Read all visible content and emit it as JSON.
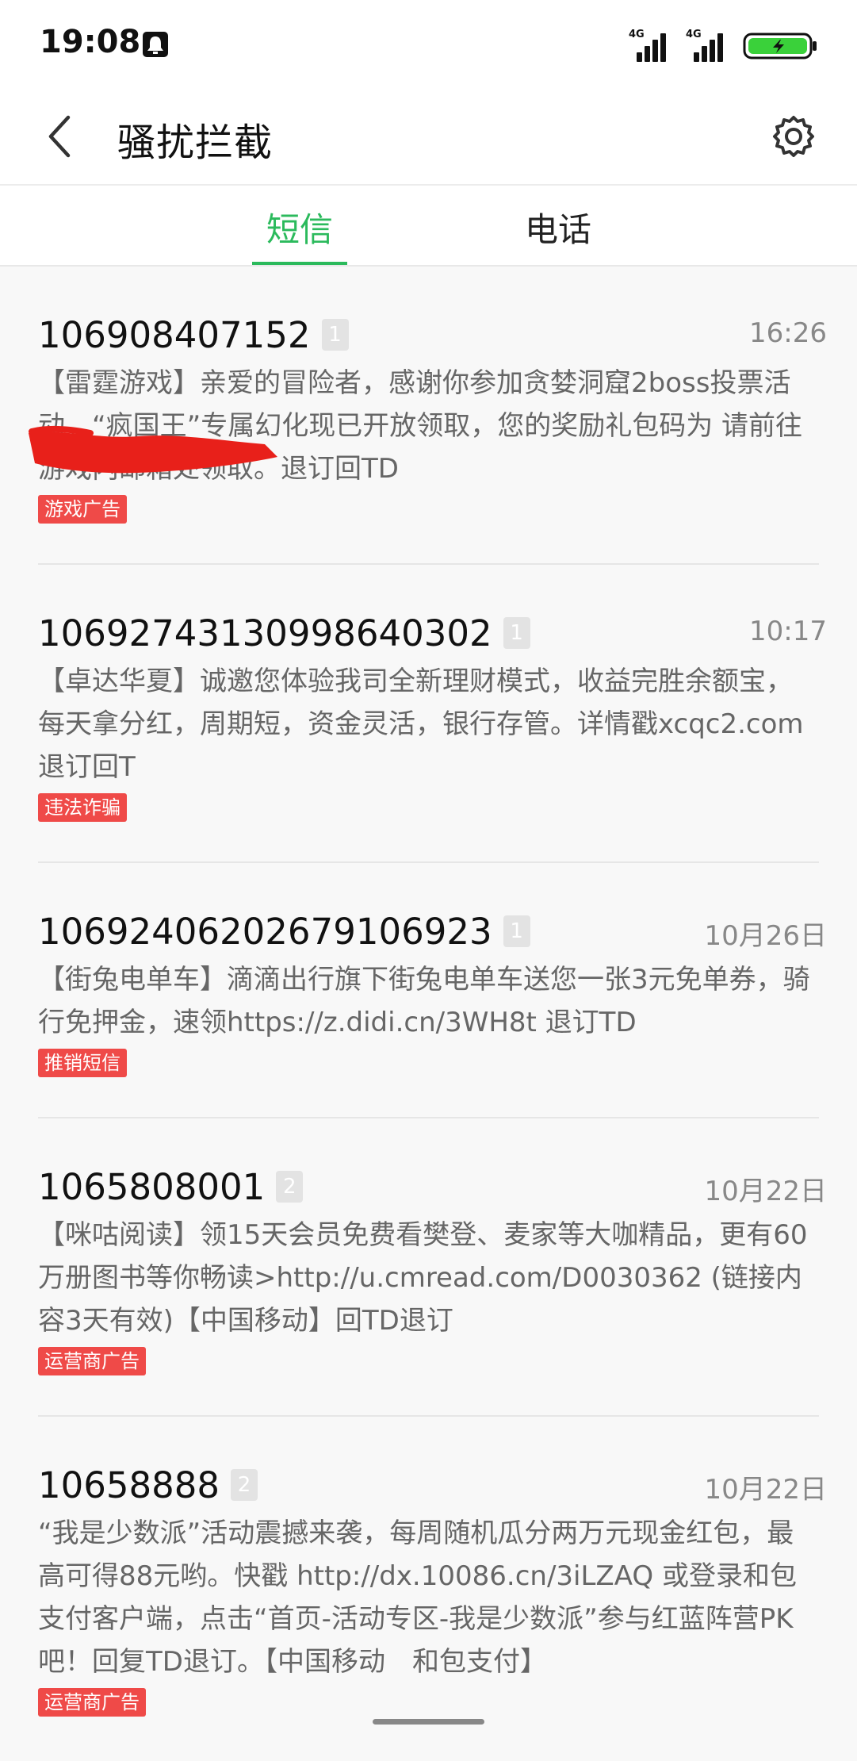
{
  "status_bar": {
    "time": "19:08",
    "network_label_1": "4G",
    "network_label_2": "4G"
  },
  "header": {
    "title": "骚扰拦截",
    "back_icon": "chevron-left-icon",
    "settings_icon": "gear-icon"
  },
  "tabs": [
    {
      "label": "短信",
      "active": true
    },
    {
      "label": "电话",
      "active": false
    }
  ],
  "colors": {
    "accent": "#2bba5c",
    "tag": "#ef4a48",
    "battery": "#3ad13a"
  },
  "messages": [
    {
      "sender": "106908407152",
      "count": "1",
      "time": "16:26",
      "body": "【雷霆游戏】亲爱的冒险者，感谢你参加贪婪洞窟2boss投票活动，“疯国王”专属幻化现已开放领取，您的奖励礼包码为           请前往游戏内邮箱处领取。退订回TD",
      "tag": "游戏广告"
    },
    {
      "sender": "10692743130998640302",
      "count": "1",
      "time": "10:17",
      "body": "【卓达华夏】诚邀您体验我司全新理财模式，收益完胜余额宝，每天拿分红，周期短，资金灵活，银行存管。详情戳xcqc2.com 退订回T",
      "tag": "违法诈骗"
    },
    {
      "sender": "10692406202679106923",
      "count": "1",
      "time": "10月26日",
      "body": "【街兔电单车】滴滴出行旗下街兔电单车送您一张3元免单券，骑行免押金，速领https://z.didi.cn/3WH8t 退订TD",
      "tag": "推销短信"
    },
    {
      "sender": "1065808001",
      "count": "2",
      "time": "10月22日",
      "body": "【咪咕阅读】领15天会员免费看樊登、麦家等大咖精品，更有60万册图书等你畅读>http://u.cmread.com/D0030362 (链接内容3天有效)【中国移动】回TD退订",
      "tag": "运营商广告"
    },
    {
      "sender": "10658888",
      "count": "2",
      "time": "10月22日",
      "body": "“我是少数派”活动震撼来袭，每周随机瓜分两万元现金红包，最高可得88元哟。快戳 http://dx.10086.cn/3iLZAQ 或登录和包支付客户端，点击“首页-活动专区-我是少数派”参与红蓝阵营PK吧！回复TD退订。【中国移动　和包支付】",
      "tag": "运营商广告"
    }
  ]
}
